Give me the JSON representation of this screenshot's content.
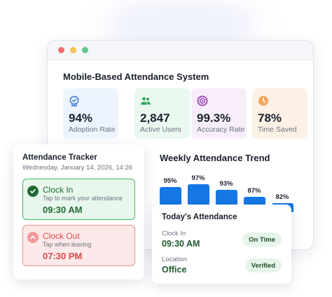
{
  "window": {
    "title": "Mobile-Based Attendance System",
    "dot_colors": [
      "#f26b6b",
      "#f5c451",
      "#5cc98a"
    ]
  },
  "stats": [
    {
      "value": "94%",
      "label": "Adoption Rate",
      "icon": "badge-check-icon",
      "bg": "#eef4fd",
      "accent": "#2f6fd6"
    },
    {
      "value": "2,847",
      "label": "Active Users",
      "icon": "users-icon",
      "bg": "#eaf8ef",
      "accent": "#2fa760"
    },
    {
      "value": "99.3%",
      "label": "Accuracy Rate",
      "icon": "target-icon",
      "bg": "#f8eefa",
      "accent": "#a24fbb"
    },
    {
      "value": "78%",
      "label": "Time Saved",
      "icon": "clock-icon",
      "bg": "#fdf1e6",
      "accent": "#e58a32"
    }
  ],
  "trend": {
    "title": "Weekly Attendance Trend"
  },
  "chart_data": {
    "type": "bar",
    "categories": [
      "",
      "",
      "",
      "",
      ""
    ],
    "values": [
      95,
      97,
      93,
      87,
      82
    ],
    "value_labels": [
      "95%",
      "97%",
      "93%",
      "87%",
      "82%"
    ],
    "title": "Weekly Attendance Trend",
    "color": "#1677e6",
    "grid": false
  },
  "tracker": {
    "title": "Attendance Tracker",
    "date": "Wednesday, January 14, 2026, 14:26",
    "clock_in": {
      "label": "Clock In",
      "hint": "Tap to mark your attendance",
      "time": "09:30 AM",
      "color": "#1f6a33",
      "icon": "check-circle-icon"
    },
    "clock_out": {
      "label": "Clock Out",
      "hint": "Tap when leaving",
      "time": "07:30 PM",
      "color": "#d94c4c",
      "icon": "chevron-up-circle-icon"
    }
  },
  "today": {
    "title": "Today's Attendance",
    "rows": [
      {
        "label": "Clock In",
        "value": "09:30 AM",
        "status": "On Time"
      },
      {
        "label": "Location",
        "value": "Office",
        "status": "Verified"
      }
    ]
  }
}
